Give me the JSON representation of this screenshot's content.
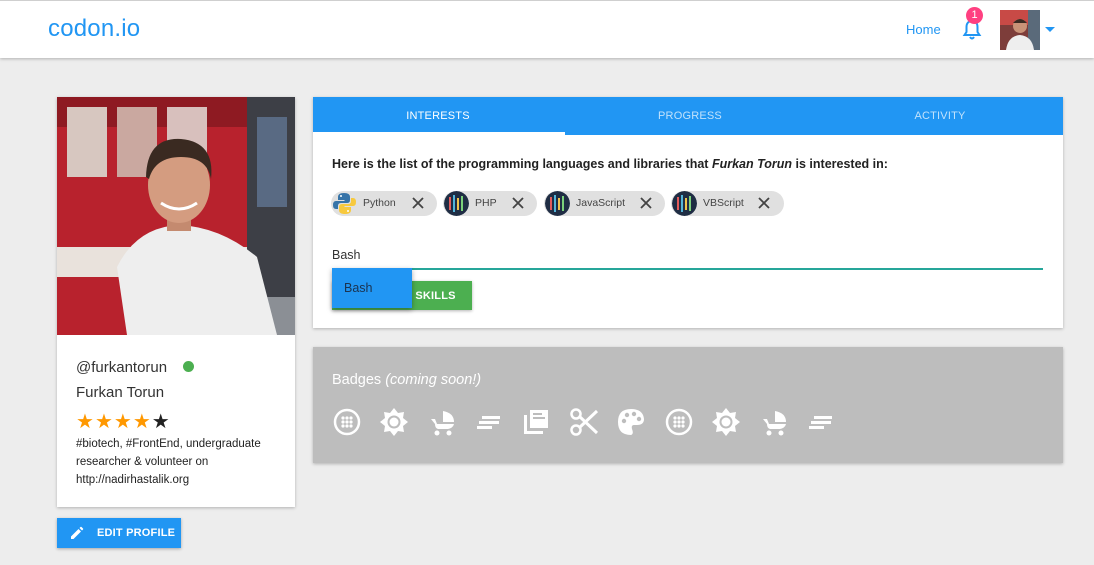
{
  "navbar": {
    "brand": "codon.io",
    "home_label": "Home",
    "notification_count": "1"
  },
  "profile": {
    "username": "@furkantorun",
    "full_name": "Furkan Torun",
    "rating": 4,
    "rating_max": 5,
    "bio": "#biotech, #FrontEnd, undergraduate researcher & volunteer on http://nadirhastalik.org",
    "online": true,
    "edit_label": "EDIT PROFILE"
  },
  "tabs": [
    {
      "label": "INTERESTS",
      "active": true
    },
    {
      "label": "PROGRESS",
      "active": false
    },
    {
      "label": "ACTIVITY",
      "active": false
    }
  ],
  "interests": {
    "intro_before": "Here is the list of the programming languages and libraries that ",
    "intro_name": "Furkan Torun",
    "intro_after": " is interested in:",
    "chips": [
      {
        "name": "Python",
        "icon": "python-logo-icon"
      },
      {
        "name": "PHP",
        "icon": "code-thumbnail-icon"
      },
      {
        "name": "JavaScript",
        "icon": "code-thumbnail-icon"
      },
      {
        "name": "VBScript",
        "icon": "code-thumbnail-icon"
      }
    ],
    "input_value": "Bash",
    "add_button_label": "ADD YOUR SKILLS",
    "add_button_visible_label": "UR SKILLS",
    "autocomplete_option": "Bash"
  },
  "badges": {
    "title": "Badges",
    "title_note": "(coming soon!)",
    "icons": [
      "blur-circular-icon",
      "brightness-icon",
      "stroller-icon",
      "short-text-icon",
      "library-books-icon",
      "scissors-icon",
      "palette-icon",
      "blur-circular-icon",
      "brightness-icon",
      "stroller-icon",
      "short-text-icon"
    ]
  },
  "colors": {
    "primary": "#2196f3",
    "success": "#4caf50",
    "accent": "#ff4081",
    "star": "#ff9800",
    "underline": "#26a69a"
  }
}
